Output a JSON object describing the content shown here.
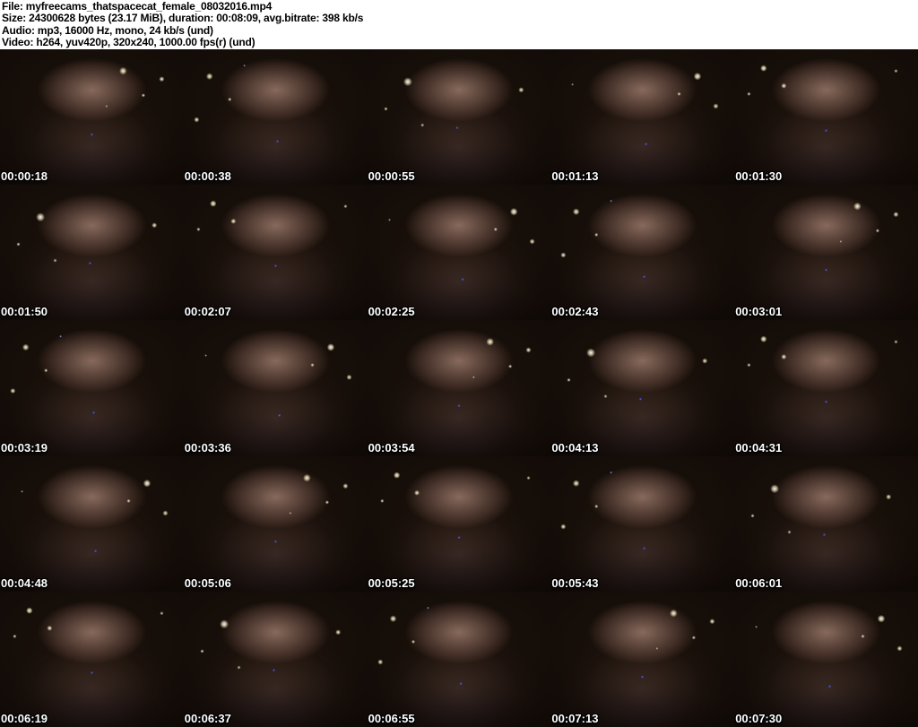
{
  "header": {
    "lines": [
      "File: myfreecams_thatspacecat_female_08032016.mp4",
      "Size: 24300628 bytes (23.17 MiB), duration: 00:08:09, avg.bitrate: 398 kb/s",
      "Audio: mp3, 16000 Hz, mono, 24 kb/s (und)",
      "Video: h264, yuv420p, 320x240, 1000.00 fps(r) (und)"
    ]
  },
  "grid": {
    "rows": 5,
    "cols": 5,
    "timestamps": [
      "00:00:18",
      "00:00:38",
      "00:00:55",
      "00:01:13",
      "00:01:30",
      "00:01:50",
      "00:02:07",
      "00:02:25",
      "00:02:43",
      "00:03:01",
      "00:03:19",
      "00:03:36",
      "00:03:54",
      "00:04:13",
      "00:04:31",
      "00:04:48",
      "00:05:06",
      "00:05:25",
      "00:05:43",
      "00:06:01",
      "00:06:19",
      "00:06:37",
      "00:06:55",
      "00:07:13",
      "00:07:30"
    ]
  },
  "colors": {
    "header_bg": "#ffffff",
    "header_text": "#000000",
    "timestamp_text": "#ffffff",
    "timestamp_outline": "#000000",
    "thumb_base": "#0b0706",
    "string_light": "#fff6d8",
    "led_blue": "#5566ff"
  }
}
